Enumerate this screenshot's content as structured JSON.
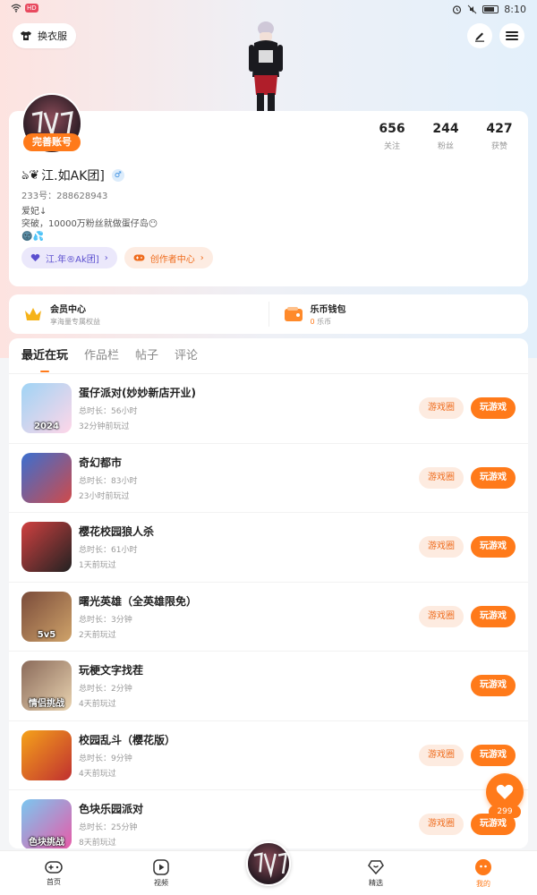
{
  "status_bar": {
    "time": "8:10",
    "hd": "HD"
  },
  "header": {
    "outfit_label": "换衣服"
  },
  "profile": {
    "complete_label": "完善账号",
    "username": "江.如AK团]",
    "username_prefix": "ঌ❦",
    "uid": "233号：288628943",
    "bio": [
      "爱妃↓",
      "突破，10000万粉丝就做蛋仔岛😶",
      "🌚💦"
    ],
    "stats": [
      {
        "num": "656",
        "label": "关注"
      },
      {
        "num": "244",
        "label": "粉丝"
      },
      {
        "num": "427",
        "label": "获赞"
      }
    ],
    "tags": [
      {
        "label": "江.年®Ak团]"
      },
      {
        "label": "创作者中心"
      }
    ]
  },
  "benefits": [
    {
      "title": "会员中心",
      "sub": "享海量专属权益"
    },
    {
      "title": "乐币钱包",
      "sub_num": "0",
      "sub_unit": " 乐币"
    }
  ],
  "tabs": [
    "最近在玩",
    "作品栏",
    "帖子",
    "评论"
  ],
  "games": [
    {
      "name": "蛋仔派对(妙妙新店开业)",
      "duration": "总时长：56小时",
      "last": "32分钟前玩过",
      "circle": "游戏圈",
      "play": "玩游戏",
      "icon_label": "2024",
      "colors": [
        "#9fd4f5",
        "#ffd6e8"
      ]
    },
    {
      "name": "奇幻都市",
      "duration": "总时长：83小时",
      "last": "23小时前玩过",
      "circle": "游戏圈",
      "play": "玩游戏",
      "icon_label": "",
      "colors": [
        "#3a6fd0",
        "#d04a4a"
      ]
    },
    {
      "name": "樱花校园狼人杀",
      "duration": "总时长：61小时",
      "last": "1天前玩过",
      "circle": "游戏圈",
      "play": "玩游戏",
      "icon_label": "",
      "colors": [
        "#d04040",
        "#222222"
      ]
    },
    {
      "name": "曙光英雄（全英雄限免）",
      "duration": "总时长：3分钟",
      "last": "2天前玩过",
      "circle": "游戏圈",
      "play": "玩游戏",
      "icon_label": "5v5",
      "colors": [
        "#7a4b3a",
        "#cfa36a"
      ]
    },
    {
      "name": "玩梗文字找茬",
      "duration": "总时长：2分钟",
      "last": "4天前玩过",
      "circle": "",
      "play": "玩游戏",
      "icon_label": "情侣挑战",
      "colors": [
        "#8a6a5a",
        "#e9d3b0"
      ]
    },
    {
      "name": "校园乱斗（樱花版）",
      "duration": "总时长：9分钟",
      "last": "4天前玩过",
      "circle": "游戏圈",
      "play": "玩游戏",
      "icon_label": "",
      "colors": [
        "#f5a21a",
        "#c03030"
      ]
    },
    {
      "name": "色块乐园派对",
      "duration": "总时长：25分钟",
      "last": "8天前玩过",
      "circle": "游戏圈",
      "play": "玩游戏",
      "icon_label": "色块挑战",
      "colors": [
        "#7ac7f0",
        "#e85aa8"
      ]
    }
  ],
  "fab": {
    "count": "299"
  },
  "nav": [
    {
      "label": "首页",
      "icon": "gamepad-icon"
    },
    {
      "label": "视频",
      "icon": "video-icon"
    },
    {
      "label": "",
      "icon": "avatar"
    },
    {
      "label": "精选",
      "icon": "heart-diamond-icon"
    },
    {
      "label": "我的",
      "icon": "profile-face-icon"
    }
  ],
  "colors": {
    "accent": "#ff7a1a",
    "purple_tag": "#5b4fcf"
  }
}
